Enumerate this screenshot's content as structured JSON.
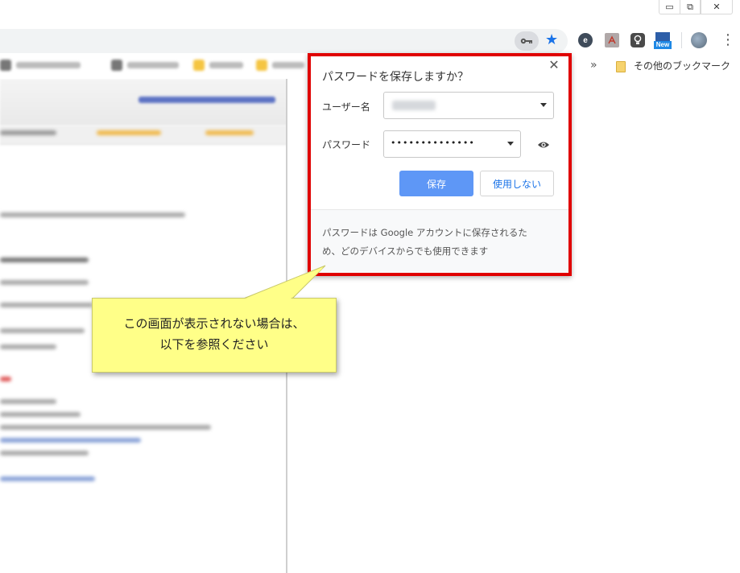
{
  "window": {
    "minimize_glyph": "▭",
    "restore_glyph": "⧉",
    "close_glyph": "✕"
  },
  "toolbar": {
    "extension_new_badge": "New",
    "menu_glyph": "⋮",
    "icons": [
      "key-icon",
      "star-icon",
      "extension-e-icon",
      "pdf-icon",
      "lightbulb-icon",
      "new-extension-icon",
      "avatar",
      "menu-icon"
    ]
  },
  "bookmarks": {
    "overflow_glyph": "»",
    "other_bookmarks": "その他のブックマーク"
  },
  "dialog": {
    "title": "パスワードを保存しますか？",
    "close_glyph": "✕",
    "username_label": "ユーザー名",
    "password_label": "パスワード",
    "password_value": "••••••••••••••",
    "save_button": "保存",
    "never_button": "使用しない",
    "footer_text": "パスワードは Google アカウントに保存されるため、どのデバイスからでも使用できます"
  },
  "callout": {
    "line1": "この画面が表示されない場合は、",
    "line2": "以下を参照ください"
  },
  "colors": {
    "highlight_border": "#e00000",
    "save_button_bg": "#5e97f6",
    "callout_bg": "#ffff88",
    "link_blue": "#1a73e8"
  }
}
